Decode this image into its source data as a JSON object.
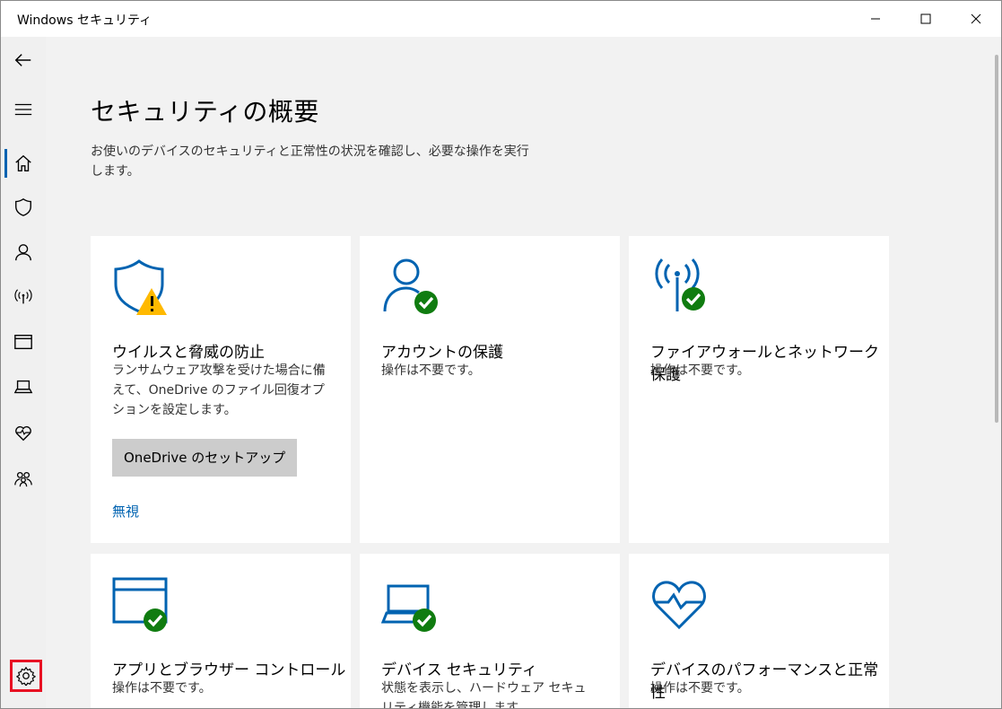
{
  "window": {
    "title": "Windows セキュリティ"
  },
  "sidebar": {
    "items": [
      {
        "name": "back-icon"
      },
      {
        "name": "menu-icon"
      },
      {
        "name": "home-icon"
      },
      {
        "name": "shield-icon"
      },
      {
        "name": "account-icon"
      },
      {
        "name": "network-icon"
      },
      {
        "name": "app-browser-icon"
      },
      {
        "name": "laptop-icon"
      },
      {
        "name": "heart-icon"
      },
      {
        "name": "family-icon"
      }
    ],
    "settings_icon": "gear-icon"
  },
  "page": {
    "title": "セキュリティの概要",
    "description": "お使いのデバイスのセキュリティと正常性の状況を確認し、必要な操作を実行します。"
  },
  "tiles": [
    {
      "title": "ウイルスと脅威の防止",
      "text": "ランサムウェア攻撃を受けた場合に備えて、OneDrive のファイル回復オプションを設定します。",
      "button": "OneDrive のセットアップ",
      "link": "無視",
      "status": "warning"
    },
    {
      "title": "アカウントの保護",
      "text": "操作は不要です。",
      "status": "ok"
    },
    {
      "title": "ファイアウォールとネットワーク保護",
      "text": "操作は不要です。",
      "status": "ok"
    },
    {
      "title": "アプリとブラウザー コントロール",
      "text": "操作は不要です。",
      "status": "ok"
    },
    {
      "title": "デバイス セキュリティ",
      "text": "状態を表示し、ハードウェア セキュリティ機能を管理します。",
      "status": "ok"
    },
    {
      "title": "デバイスのパフォーマンスと正常性",
      "text": "操作は不要です。",
      "status": "ok"
    }
  ],
  "colors": {
    "accent": "#0063b1",
    "ok": "#107c10",
    "warning": "#ffb900",
    "highlight": "#e81123"
  }
}
